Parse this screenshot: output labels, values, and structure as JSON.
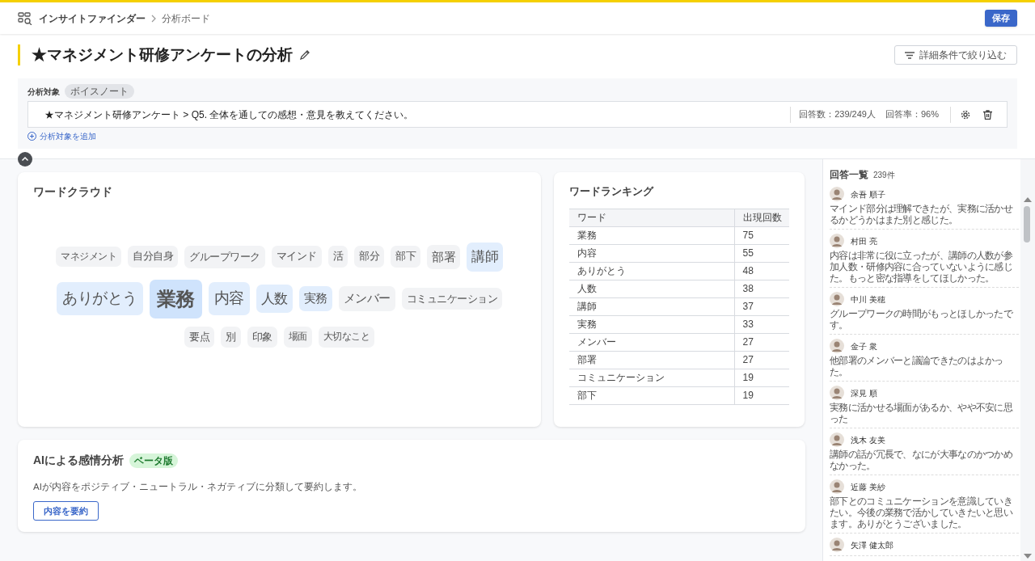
{
  "header": {
    "app_name": "インサイトファインダー",
    "breadcrumb": "分析ボード",
    "save_button": "保存"
  },
  "title": "★マネジメント研修アンケートの分析",
  "filter_button": "詳細条件で絞り込む",
  "target": {
    "label": "分析対象",
    "tag": "ボイスノート",
    "question": "★マネジメント研修アンケート > Q5. 全体を通しての感想・意見を教えてください。",
    "answer_count": "回答数：239/249人",
    "answer_rate": "回答率：96%",
    "add_link": "分析対象を追加"
  },
  "word_cloud": {
    "title": "ワードクラウド",
    "words": [
      {
        "word": "マネジメント",
        "kind": "xs",
        "highlighted": false
      },
      {
        "word": "自分自身",
        "kind": "sm",
        "highlighted": false
      },
      {
        "word": "グループワーク",
        "kind": "md",
        "highlighted": false
      },
      {
        "word": "マインド",
        "kind": "sm",
        "highlighted": false
      },
      {
        "word": "活",
        "kind": "sm",
        "highlighted": false
      },
      {
        "word": "部分",
        "kind": "sm",
        "highlighted": false
      },
      {
        "word": "部下",
        "kind": "sm",
        "highlighted": false
      },
      {
        "word": "部署",
        "kind": "lg",
        "highlighted": false
      },
      {
        "word": "講師",
        "kind": "xl",
        "highlighted": true
      },
      {
        "word": "ありがとう",
        "kind": "xxl",
        "highlighted": true
      },
      {
        "word": "業務",
        "kind": "max",
        "highlighted": true
      },
      {
        "word": "内容",
        "kind": "xxl",
        "highlighted": true
      },
      {
        "word": "人数",
        "kind": "xl",
        "highlighted": true
      },
      {
        "word": "実務",
        "kind": "lg",
        "highlighted": true
      },
      {
        "word": "メンバー",
        "kind": "lg",
        "highlighted": false
      },
      {
        "word": "コミュニケーション",
        "kind": "md",
        "highlighted": false
      },
      {
        "word": "要点",
        "kind": "sm",
        "highlighted": false
      },
      {
        "word": "別",
        "kind": "sm",
        "highlighted": false
      },
      {
        "word": "印象",
        "kind": "sm",
        "highlighted": false
      },
      {
        "word": "場面",
        "kind": "xs",
        "highlighted": false
      },
      {
        "word": "大切なこと",
        "kind": "xs",
        "highlighted": false
      }
    ]
  },
  "ranking": {
    "title": "ワードランキング",
    "columns": [
      "ワード",
      "出現回数"
    ],
    "rows": [
      [
        "業務",
        "75"
      ],
      [
        "内容",
        "55"
      ],
      [
        "ありがとう",
        "48"
      ],
      [
        "人数",
        "38"
      ],
      [
        "講師",
        "37"
      ],
      [
        "実務",
        "33"
      ],
      [
        "メンバー",
        "27"
      ],
      [
        "部署",
        "27"
      ],
      [
        "コミュニケーション",
        "19"
      ],
      [
        "部下",
        "19"
      ]
    ]
  },
  "sentiment": {
    "title": "AIによる感情分析",
    "badge": "ベータ版",
    "description": "AIが内容をポジティブ・ニュートラル・ネガティブに分類して要約します。",
    "button": "内容を要約"
  },
  "responses": {
    "title": "回答一覧",
    "count": "239件",
    "items": [
      {
        "name": "余吾 順子",
        "comment": "マインド部分は理解できたが、実務に活かせるかどうかはまた別と感じた。"
      },
      {
        "name": "村田 亮",
        "comment": "内容は非常に役に立ったが、講師の人数が参加人数・研修内容に合っていないように感じた。もっと密な指導をしてほしかった。"
      },
      {
        "name": "中川 美穂",
        "comment": "グループワークの時間がもっとほしかったです。"
      },
      {
        "name": "金子 衆",
        "comment": "他部署のメンバーと議論できたのはよかった。"
      },
      {
        "name": "深見 順",
        "comment": "実務に活かせる場面があるか、やや不安に思った"
      },
      {
        "name": "浅木 友美",
        "comment": "講師の話が冗長で、なにが大事なのかつかめなかった。"
      },
      {
        "name": "近藤 美紗",
        "comment": "部下とのコミュニケーションを意識していきたい。今後の業務で活かしていきたいと思います。ありがとうございました。"
      },
      {
        "name": "矢澤 健太郎"
      }
    ]
  }
}
